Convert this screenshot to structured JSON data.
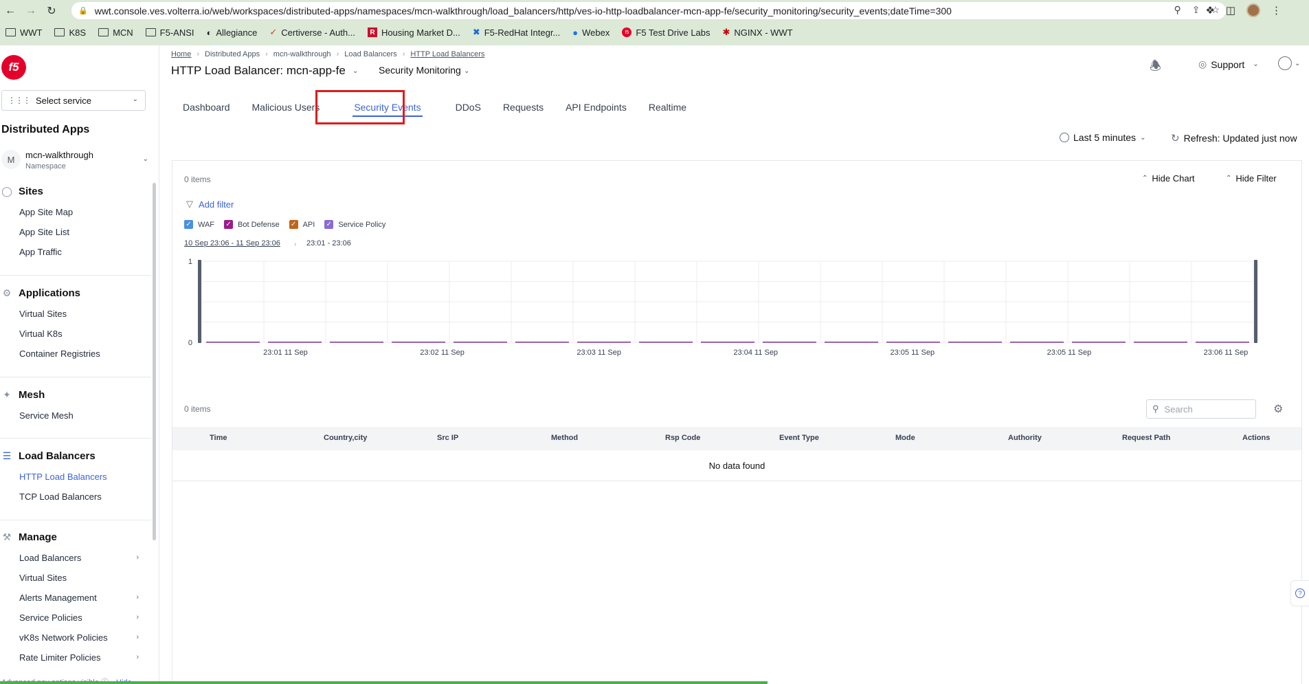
{
  "browser": {
    "url": "wwt.console.ves.volterra.io/web/workspaces/distributed-apps/namespaces/mcn-walkthrough/load_balancers/http/ves-io-http-loadbalancer-mcn-app-fe/security_monitoring/security_events;dateTime=300",
    "bookmarks": [
      "WWT",
      "K8S",
      "MCN",
      "F5-ANSI",
      "Allegiance",
      "Certiverse - Auth...",
      "Housing Market D...",
      "F5-RedHat Integr...",
      "Webex",
      "F5 Test Drive Labs",
      "NGINX - WWT"
    ]
  },
  "sidebar": {
    "logo_text": "f5",
    "select_service": "Select service",
    "app_title": "Distributed Apps",
    "namespace": {
      "initial": "M",
      "name": "mcn-walkthrough",
      "label": "Namespace"
    },
    "sections": [
      {
        "title": "Sites",
        "items": [
          "App Site Map",
          "App Site List",
          "App Traffic"
        ]
      },
      {
        "title": "Applications",
        "items": [
          "Virtual Sites",
          "Virtual K8s",
          "Container Registries"
        ]
      },
      {
        "title": "Mesh",
        "items": [
          "Service Mesh"
        ]
      },
      {
        "title": "Load Balancers",
        "items": [
          "HTTP Load Balancers",
          "TCP Load Balancers"
        ]
      },
      {
        "title": "Manage",
        "items": [
          "Load Balancers",
          "Virtual Sites",
          "Alerts Management",
          "Service Policies",
          "vK8s Network Policies",
          "Rate Limiter Policies"
        ]
      }
    ],
    "active_item": "HTTP Load Balancers",
    "adv_options": "Advanced nav options visible",
    "hide_label": "Hide"
  },
  "header": {
    "breadcrumb": [
      "Home",
      "Distributed Apps",
      "mcn-walkthrough",
      "Load Balancers",
      "HTTP Load Balancers"
    ],
    "title": "HTTP Load Balancer: mcn-app-fe",
    "monitor_select": "Security Monitoring",
    "support": "Support"
  },
  "tabs": [
    "Dashboard",
    "Malicious Users",
    "Security Events",
    "DDoS",
    "Requests",
    "API Endpoints",
    "Realtime"
  ],
  "active_tab": "Security Events",
  "toolbar": {
    "time_range": "Last 5 minutes",
    "refresh": "Refresh: Updated just now"
  },
  "events": {
    "items_count": "0 items",
    "hide_chart": "Hide Chart",
    "hide_filter": "Hide Filter",
    "add_filter": "Add filter",
    "legend": [
      {
        "label": "WAF",
        "color": "#4a90e2"
      },
      {
        "label": "Bot Defense",
        "color": "#9b1c8c"
      },
      {
        "label": "API",
        "color": "#c0651a"
      },
      {
        "label": "Service Policy",
        "color": "#8a6bd4"
      }
    ],
    "range_main": "10 Sep 23:06 - 11 Sep 23:06",
    "range_sub": "23:01 - 23:06",
    "search_placeholder": "Search",
    "columns": [
      "Time",
      "Country,city",
      "Src IP",
      "Method",
      "Rsp Code",
      "Event Type",
      "Mode",
      "Authority",
      "Request Path",
      "Actions"
    ],
    "no_data": "No data found"
  },
  "chart_data": {
    "type": "bar",
    "ylim": [
      0,
      1
    ],
    "yticks": [
      "1",
      "0"
    ],
    "xtick_labels": [
      "23:01 11 Sep",
      "23:02 11 Sep",
      "23:03 11 Sep",
      "23:04 11 Sep",
      "23:05 11 Sep",
      "23:05 11 Sep",
      "23:06 11 Sep"
    ],
    "series": [
      {
        "name": "WAF",
        "values": [
          0,
          0,
          0,
          0,
          0,
          0,
          0,
          0,
          0,
          0,
          0,
          0,
          0,
          0,
          0,
          0,
          0
        ]
      },
      {
        "name": "Bot Defense",
        "values": [
          0,
          0,
          0,
          0,
          0,
          0,
          0,
          0,
          0,
          0,
          0,
          0,
          0,
          0,
          0,
          0,
          0
        ]
      },
      {
        "name": "API",
        "values": [
          0,
          0,
          0,
          0,
          0,
          0,
          0,
          0,
          0,
          0,
          0,
          0,
          0,
          0,
          0,
          0,
          0
        ]
      },
      {
        "name": "Service Policy",
        "values": [
          0,
          0,
          0,
          0,
          0,
          0,
          0,
          0,
          0,
          0,
          0,
          0,
          0,
          0,
          0,
          0,
          0
        ]
      }
    ],
    "bin_count": 17,
    "grid": true,
    "brush_color": "#565e6e",
    "series_line_color": "#7b2d90"
  }
}
